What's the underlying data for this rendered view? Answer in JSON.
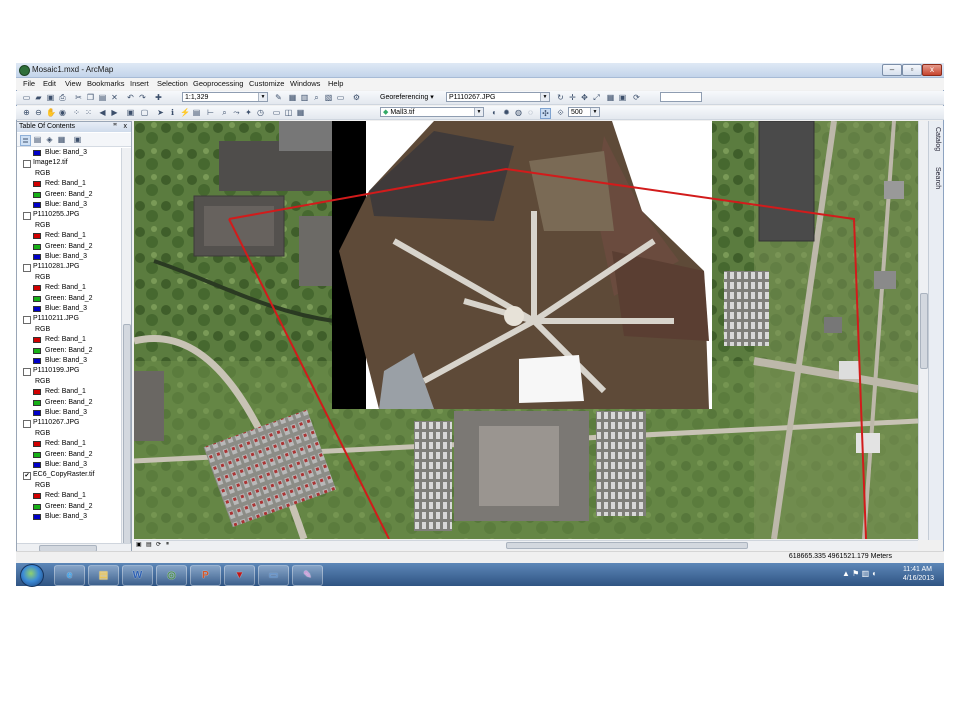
{
  "window": {
    "title": "Mosaic1.mxd - ArcMap"
  },
  "menu": [
    "File",
    "Edit",
    "View",
    "Bookmarks",
    "Insert",
    "Selection",
    "Geoprocessing",
    "Customize",
    "Windows",
    "Help"
  ],
  "toolbar": {
    "scale": "1:1,329",
    "georef_label": "Georeferencing ▾",
    "georef_layer": "P1110267.JPG",
    "raster_layer": "Mall3.tif",
    "zoom_value": "500"
  },
  "toc": {
    "title": "Table Of Contents",
    "close_glyph": "x",
    "rows": [
      {
        "kind": "band",
        "color": "#0000c8",
        "label": "Blue:  Band_3"
      },
      {
        "kind": "layer",
        "checked": "",
        "label": "Image12.tif"
      },
      {
        "kind": "rgb",
        "label": "RGB"
      },
      {
        "kind": "band",
        "color": "#d00000",
        "label": "Red:   Band_1"
      },
      {
        "kind": "band",
        "color": "#16b016",
        "label": "Green: Band_2"
      },
      {
        "kind": "band",
        "color": "#0000c8",
        "label": "Blue:  Band_3"
      },
      {
        "kind": "layer",
        "checked": "",
        "label": "P1110255.JPG"
      },
      {
        "kind": "rgb",
        "label": "RGB"
      },
      {
        "kind": "band",
        "color": "#d00000",
        "label": "Red:   Band_1"
      },
      {
        "kind": "band",
        "color": "#16b016",
        "label": "Green: Band_2"
      },
      {
        "kind": "band",
        "color": "#0000c8",
        "label": "Blue:  Band_3"
      },
      {
        "kind": "layer",
        "checked": "",
        "label": "P1110281.JPG"
      },
      {
        "kind": "rgb",
        "label": "RGB"
      },
      {
        "kind": "band",
        "color": "#d00000",
        "label": "Red:   Band_1"
      },
      {
        "kind": "band",
        "color": "#16b016",
        "label": "Green: Band_2"
      },
      {
        "kind": "band",
        "color": "#0000c8",
        "label": "Blue:  Band_3"
      },
      {
        "kind": "layer",
        "checked": "",
        "label": "P1110211.JPG"
      },
      {
        "kind": "rgb",
        "label": "RGB"
      },
      {
        "kind": "band",
        "color": "#d00000",
        "label": "Red:   Band_1"
      },
      {
        "kind": "band",
        "color": "#16b016",
        "label": "Green: Band_2"
      },
      {
        "kind": "band",
        "color": "#0000c8",
        "label": "Blue:  Band_3"
      },
      {
        "kind": "layer",
        "checked": "",
        "label": "P1110199.JPG"
      },
      {
        "kind": "rgb",
        "label": "RGB"
      },
      {
        "kind": "band",
        "color": "#d00000",
        "label": "Red:   Band_1"
      },
      {
        "kind": "band",
        "color": "#16b016",
        "label": "Green: Band_2"
      },
      {
        "kind": "band",
        "color": "#0000c8",
        "label": "Blue:  Band_3"
      },
      {
        "kind": "layer",
        "checked": "",
        "label": "P1110267.JPG"
      },
      {
        "kind": "rgb",
        "label": "RGB"
      },
      {
        "kind": "band",
        "color": "#d00000",
        "label": "Red:   Band_1"
      },
      {
        "kind": "band",
        "color": "#16b016",
        "label": "Green: Band_2"
      },
      {
        "kind": "band",
        "color": "#0000c8",
        "label": "Blue:  Band_3"
      },
      {
        "kind": "layer",
        "checked": "✔",
        "label": "EC6_CopyRaster.tif"
      },
      {
        "kind": "rgb",
        "label": "RGB"
      },
      {
        "kind": "band",
        "color": "#d00000",
        "label": "Red:   Band_1"
      },
      {
        "kind": "band",
        "color": "#16b016",
        "label": "Green: Band_2"
      },
      {
        "kind": "band",
        "color": "#0000c8",
        "label": "Blue:  Band_3"
      }
    ]
  },
  "side_tabs": [
    "Catalog",
    "Search"
  ],
  "status": {
    "coords": "618665.335  4961521.179 Meters"
  },
  "taskbar": {
    "apps": [
      {
        "name": "ie",
        "glyph": "e",
        "color": "#3aa0e8"
      },
      {
        "name": "explorer",
        "glyph": "▤",
        "color": "#e8c55a"
      },
      {
        "name": "word",
        "glyph": "W",
        "color": "#2b5fb4"
      },
      {
        "name": "arcmap",
        "glyph": "◎",
        "color": "#4a8f4a"
      },
      {
        "name": "powerpoint",
        "glyph": "P",
        "color": "#d2562a"
      },
      {
        "name": "app-red",
        "glyph": "▼",
        "color": "#c01818"
      },
      {
        "name": "app-window",
        "glyph": "▭",
        "color": "#4f86c6"
      },
      {
        "name": "paint",
        "glyph": "✎",
        "color": "#c9a0d8"
      }
    ],
    "time": "11:41 AM",
    "date": "4/16/2013"
  }
}
